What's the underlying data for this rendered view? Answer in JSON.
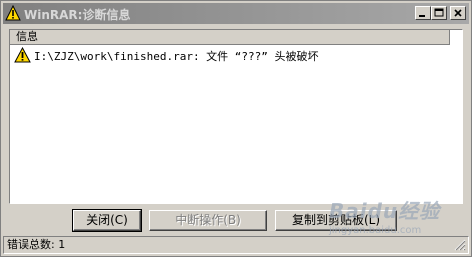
{
  "window": {
    "title": "WinRAR:诊断信息"
  },
  "list": {
    "column_header": "信息",
    "rows": [
      {
        "icon": "warning-icon",
        "text": "I:\\ZJZ\\work\\finished.rar: 文件 “???” 头被破坏"
      }
    ]
  },
  "buttons": {
    "close_label": "关闭(C)",
    "stop_label": "中断操作(B)",
    "copy_label": "复制到剪贴板(L)"
  },
  "status": {
    "text": "错误总数: 1"
  },
  "watermark": {
    "main": "Baidu经验",
    "sub": "jingyan.baidu.com"
  },
  "colors": {
    "title_gradient_start": "#808080",
    "title_gradient_end": "#a8a8a8",
    "face": "#d4d0c8",
    "warning_yellow": "#ffd800"
  }
}
